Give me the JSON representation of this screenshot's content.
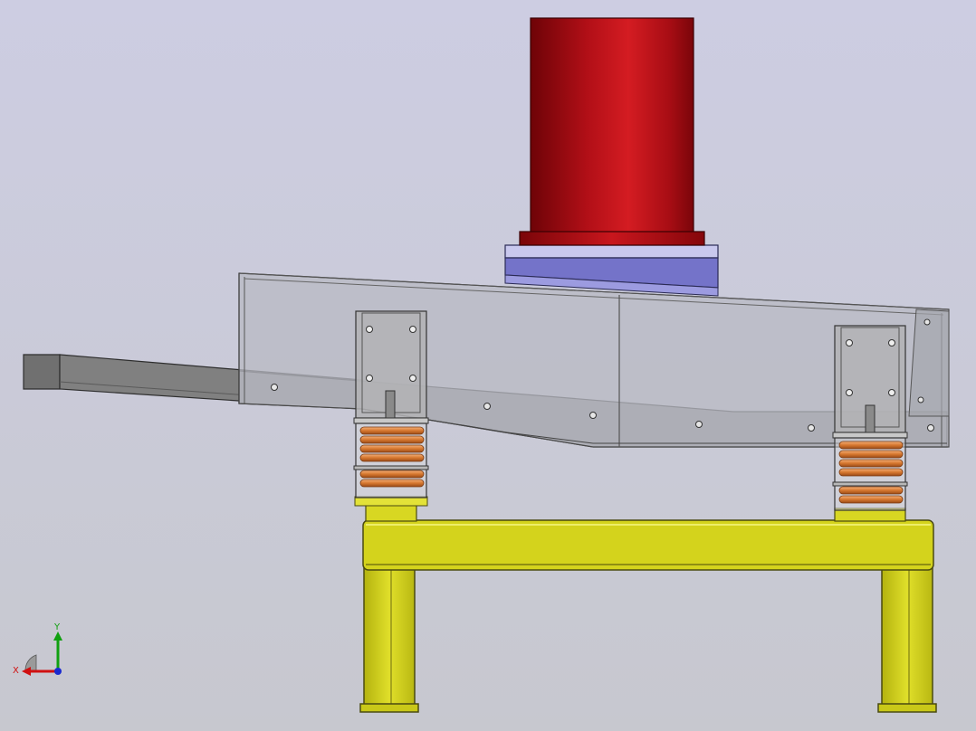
{
  "viewport": {
    "background_top": "#cdcde2",
    "background_bottom": "#c7c8cf"
  },
  "model": {
    "motor": {
      "color": "#b8141b"
    },
    "motor_mount": {
      "color": "#7876c8"
    },
    "trough": {
      "color": "#aeb0b8"
    },
    "springs": {
      "color": "#d9803a",
      "count": 2
    },
    "stand": {
      "color": "#d5d41f"
    }
  },
  "triad": {
    "x_label": "X",
    "y_label": "Y",
    "x_color": "#d01010",
    "y_color": "#10a010",
    "z_color": "#1a2ad0"
  }
}
